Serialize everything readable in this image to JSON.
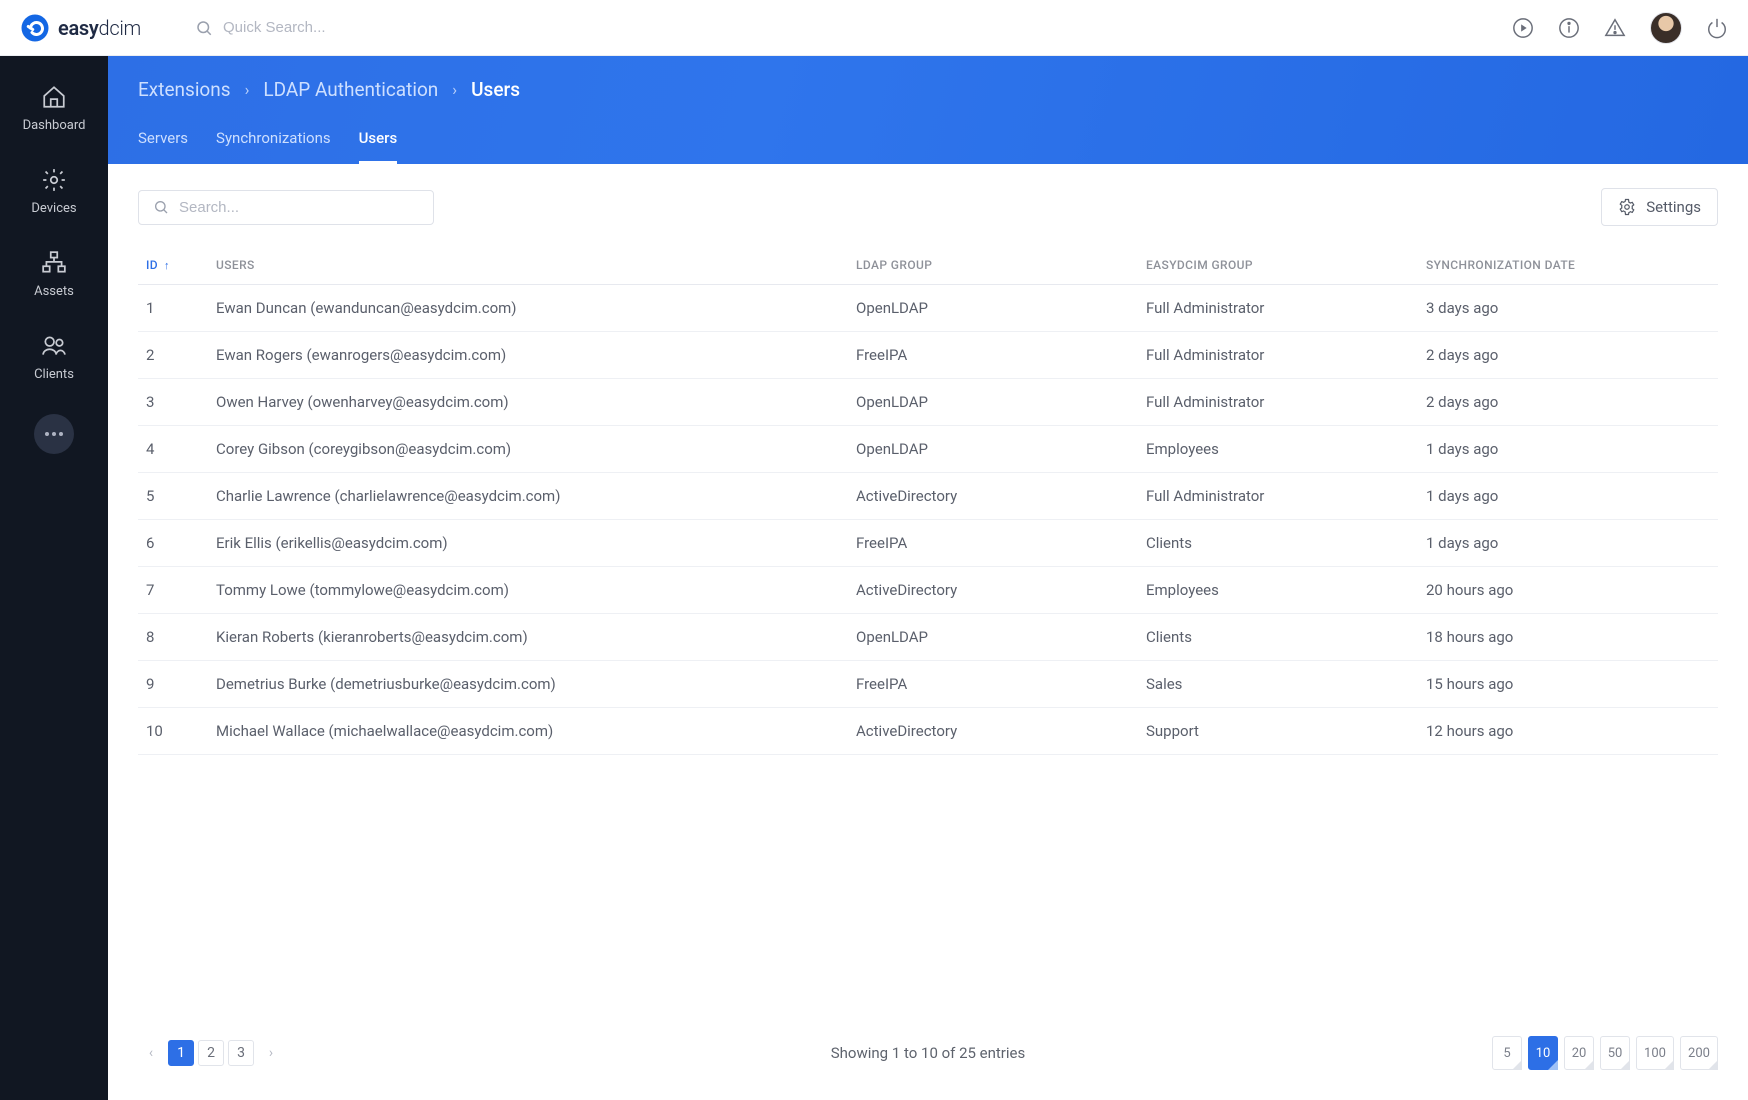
{
  "brand": {
    "name_a": "easy",
    "name_b": "dcim"
  },
  "topbar": {
    "search_placeholder": "Quick Search..."
  },
  "sidebar": {
    "items": [
      {
        "label": "Dashboard"
      },
      {
        "label": "Devices"
      },
      {
        "label": "Assets"
      },
      {
        "label": "Clients"
      }
    ]
  },
  "breadcrumb": {
    "items": [
      {
        "label": "Extensions",
        "current": false
      },
      {
        "label": "LDAP Authentication",
        "current": false
      },
      {
        "label": "Users",
        "current": true
      }
    ]
  },
  "tabs": [
    {
      "label": "Servers",
      "active": false
    },
    {
      "label": "Synchronizations",
      "active": false
    },
    {
      "label": "Users",
      "active": true
    }
  ],
  "toolbar": {
    "search_placeholder": "Search...",
    "settings_label": "Settings"
  },
  "columns": {
    "id": "ID",
    "users": "USERS",
    "ldap_group": "LDAP GROUP",
    "easydcim_group": "EASYDCIM GROUP",
    "sync_date": "SYNCHRONIZATION DATE"
  },
  "rows": [
    {
      "id": "1",
      "user": "Ewan Duncan (ewanduncan@easydcim.com)",
      "ldap": "OpenLDAP",
      "grp": "Full Administrator",
      "sync": "3 days ago"
    },
    {
      "id": "2",
      "user": "Ewan Rogers (ewanrogers@easydcim.com)",
      "ldap": "FreeIPA",
      "grp": "Full Administrator",
      "sync": "2 days ago"
    },
    {
      "id": "3",
      "user": "Owen Harvey (owenharvey@easydcim.com)",
      "ldap": "OpenLDAP",
      "grp": "Full Administrator",
      "sync": "2 days ago"
    },
    {
      "id": "4",
      "user": "Corey Gibson (coreygibson@easydcim.com)",
      "ldap": "OpenLDAP",
      "grp": "Employees",
      "sync": "1 days ago"
    },
    {
      "id": "5",
      "user": "Charlie Lawrence (charlielawrence@easydcim.com)",
      "ldap": "ActiveDirectory",
      "grp": "Full Administrator",
      "sync": "1 days ago"
    },
    {
      "id": "6",
      "user": "Erik Ellis (erikellis@easydcim.com)",
      "ldap": "FreeIPA",
      "grp": "Clients",
      "sync": "1 days ago"
    },
    {
      "id": "7",
      "user": "Tommy Lowe (tommylowe@easydcim.com)",
      "ldap": "ActiveDirectory",
      "grp": "Employees",
      "sync": "20 hours ago"
    },
    {
      "id": "8",
      "user": "Kieran Roberts (kieranroberts@easydcim.com)",
      "ldap": "OpenLDAP",
      "grp": "Clients",
      "sync": "18 hours ago"
    },
    {
      "id": "9",
      "user": "Demetrius Burke (demetriusburke@easydcim.com)",
      "ldap": "FreeIPA",
      "grp": "Sales",
      "sync": "15 hours ago"
    },
    {
      "id": "10",
      "user": "Michael Wallace (michaelwallace@easydcim.com)",
      "ldap": "ActiveDirectory",
      "grp": "Support",
      "sync": "12 hours ago"
    }
  ],
  "pagination": {
    "pages": [
      "1",
      "2",
      "3"
    ],
    "active_page": "1",
    "summary": "Showing 1 to 10 of 25 entries",
    "sizes": [
      "5",
      "10",
      "20",
      "50",
      "100",
      "200"
    ],
    "active_size": "10"
  }
}
